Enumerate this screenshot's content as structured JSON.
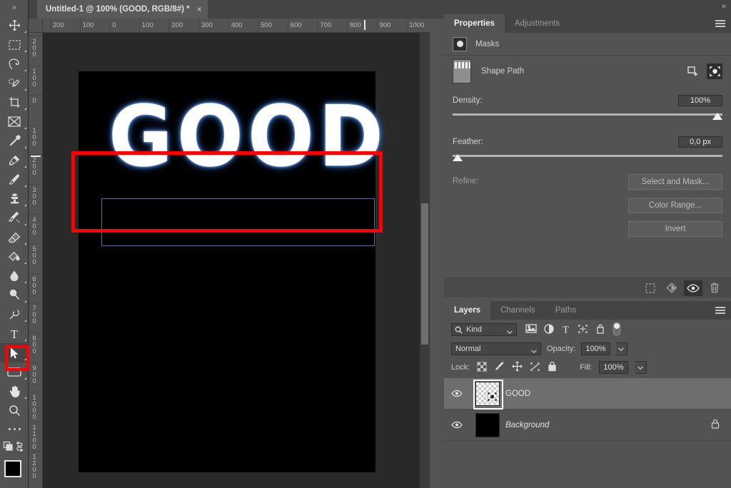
{
  "window": {
    "expand_chevrons": "»"
  },
  "document_tab": {
    "title": "Untitled-1 @ 100% (GOOD, RGB/8#) *",
    "close_label": "×"
  },
  "rulers": {
    "horizontal_labels": [
      "200",
      "100",
      "0",
      "100",
      "200",
      "300",
      "400",
      "500",
      "600",
      "700",
      "800",
      "900",
      "1000"
    ],
    "vertical_labels": [
      "200",
      "100",
      "0",
      "100",
      "200",
      "300",
      "400",
      "500",
      "600",
      "700",
      "800",
      "900",
      "1000",
      "1100",
      "1200"
    ]
  },
  "canvas": {
    "artwork_text": "GOOD",
    "background_color": "#000000",
    "text_color": "#ffffff",
    "glow_color": "#6fa0e0",
    "path_bbox_color": "#5b6f96",
    "annotation_color": "#fe0000"
  },
  "toolbar": {
    "tools": [
      {
        "name": "move-tool",
        "icon": "move-icon"
      },
      {
        "name": "rectangular-marquee-tool",
        "icon": "marquee-icon"
      },
      {
        "name": "lasso-tool",
        "icon": "lasso-icon"
      },
      {
        "name": "object-selection-tool",
        "icon": "quick-selection-icon"
      },
      {
        "name": "crop-tool",
        "icon": "crop-icon"
      },
      {
        "name": "frame-tool",
        "icon": "frame-icon"
      },
      {
        "name": "eyedropper-tool",
        "icon": "eyedropper-icon"
      },
      {
        "name": "spot-healing-brush-tool",
        "icon": "healing-brush-icon"
      },
      {
        "name": "brush-tool",
        "icon": "brush-icon"
      },
      {
        "name": "clone-stamp-tool",
        "icon": "stamp-icon"
      },
      {
        "name": "history-brush-tool",
        "icon": "history-brush-icon"
      },
      {
        "name": "eraser-tool",
        "icon": "eraser-icon"
      },
      {
        "name": "gradient-tool",
        "icon": "paint-bucket-icon"
      },
      {
        "name": "blur-tool",
        "icon": "blur-drop-icon"
      },
      {
        "name": "dodge-tool",
        "icon": "dodge-icon"
      },
      {
        "name": "pen-tool",
        "icon": "pen-icon"
      },
      {
        "name": "type-tool",
        "icon": "type-icon"
      },
      {
        "name": "direct-selection-tool",
        "icon": "path-arrow-icon"
      },
      {
        "name": "rectangle-tool",
        "icon": "rectangle-icon"
      },
      {
        "name": "hand-tool",
        "icon": "hand-icon"
      },
      {
        "name": "zoom-tool",
        "icon": "magnifier-icon"
      }
    ],
    "more_tools_label": "•••",
    "foreground_color": "#000000",
    "background_color": "#ffffff"
  },
  "properties_panel": {
    "tabs": [
      {
        "label": "Properties",
        "active": true
      },
      {
        "label": "Adjustments",
        "active": false
      }
    ],
    "masks_label": "Masks",
    "shape_path_label": "Shape Path",
    "density": {
      "label": "Density:",
      "value": "100%",
      "percent": 100
    },
    "feather": {
      "label": "Feather:",
      "value": "0,0 px",
      "percent": 0
    },
    "refine_label": "Refine:",
    "buttons": [
      {
        "label": "Select and Mask..."
      },
      {
        "label": "Color Range..."
      },
      {
        "label": "Invert"
      }
    ],
    "footer_icons": [
      {
        "name": "load-selection-icon",
        "active": false
      },
      {
        "name": "apply-mask-icon",
        "active": false
      },
      {
        "name": "toggle-mask-visibility-icon",
        "active": true
      },
      {
        "name": "delete-mask-icon",
        "active": false
      }
    ]
  },
  "layers_panel": {
    "tabs": [
      {
        "label": "Layers",
        "active": true
      },
      {
        "label": "Channels",
        "active": false
      },
      {
        "label": "Paths",
        "active": false
      }
    ],
    "filter": {
      "kind_label": "Kind",
      "icons": [
        "pixel-layer-filter-icon",
        "adjustment-layer-filter-icon",
        "type-layer-filter-icon",
        "shape-layer-filter-icon",
        "smart-object-filter-icon"
      ],
      "toggle_name": "filter-toggle-switch"
    },
    "blend_mode": "Normal",
    "opacity_label": "Opacity:",
    "opacity_value": "100%",
    "lock_label": "Lock:",
    "lock_icons": [
      "lock-transparent-pixels-icon",
      "lock-image-pixels-icon",
      "lock-position-icon",
      "lock-artboard-nesting-icon",
      "lock-all-icon"
    ],
    "fill_label": "Fill:",
    "fill_value": "100%",
    "layers": [
      {
        "name": "GOOD",
        "selected": true,
        "italic": false,
        "visible": true,
        "thumb_type": "checker",
        "locked": false
      },
      {
        "name": "Background",
        "selected": false,
        "italic": true,
        "visible": true,
        "thumb_type": "black",
        "locked": true
      }
    ]
  }
}
